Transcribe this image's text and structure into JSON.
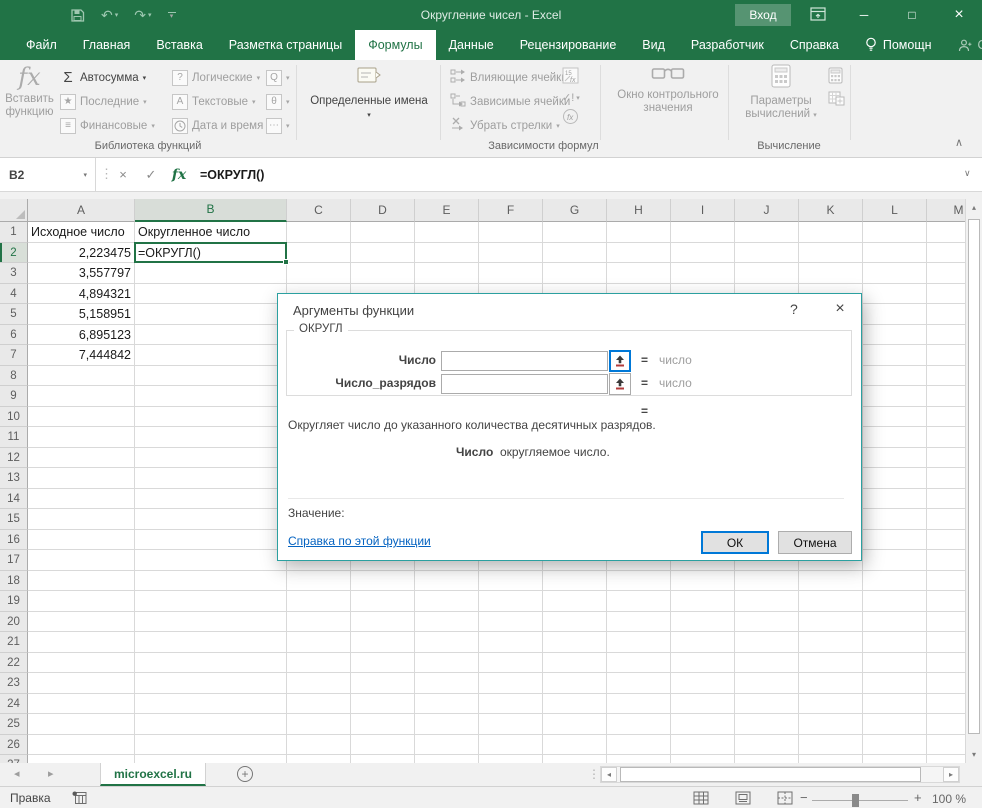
{
  "window": {
    "title": "Округление чисел - Excel",
    "sign_in_label": "Вход",
    "icons": {
      "dropdown": "▾",
      "undo": "↶",
      "redo": "↷",
      "minimize": "─",
      "maximize": "□",
      "close": "×",
      "check": "✓",
      "cancel_x": "×",
      "fx": "fx",
      "sigma": "Σ",
      "star": "★",
      "book": "≡",
      "question": "?",
      "letter_a": "A",
      "lookup": "Q",
      "theta": "θ",
      "dots": "⋯",
      "collapse": "∧",
      "expand": "∨",
      "vdots": "⋮",
      "prev": "◂",
      "next": "▸",
      "up": "▴",
      "down": "▾",
      "left": "◂",
      "right": "▸",
      "plus": "+",
      "check_error": "✓!",
      "minus": "−",
      "help": "?"
    }
  },
  "menu_tabs": [
    {
      "label": "Файл"
    },
    {
      "label": "Главная"
    },
    {
      "label": "Вставка"
    },
    {
      "label": "Разметка страницы"
    },
    {
      "label": "Формулы",
      "active": true
    },
    {
      "label": "Данные"
    },
    {
      "label": "Рецензирование"
    },
    {
      "label": "Вид"
    },
    {
      "label": "Разработчик"
    },
    {
      "label": "Справка"
    },
    {
      "label": "Помощн",
      "bulb": true
    },
    {
      "label": "Общий доступ",
      "person": true,
      "muted": true
    }
  ],
  "ribbon": {
    "insert_function": "Вставить функцию",
    "autosum": "Автосумма",
    "recent": "Последние",
    "financial": "Финансовые",
    "logical": "Логические",
    "text_fns": "Текстовые",
    "datetime": "Дата и время",
    "defined_names": "Определенные имена",
    "precedents": "Влияющие ячейки",
    "dependents": "Зависимые ячейки",
    "remove_arrows": "Убрать стрелки",
    "watch_window": "Окно контрольного значения",
    "calc_options": "Параметры вычислений",
    "group_library": "Библиотека функций",
    "group_dependencies": "Зависимости формул",
    "group_calculation": "Вычисление"
  },
  "formula_bar": {
    "name_box": "B2",
    "formula": "=ОКРУГЛ()"
  },
  "grid": {
    "columns": [
      "A",
      "B",
      "C",
      "D",
      "E",
      "F",
      "G",
      "H",
      "I",
      "J",
      "K",
      "L",
      "M"
    ],
    "col_widths": {
      "A": 107,
      "B": 152,
      "default": 64
    },
    "row_count": 27,
    "active_cell": {
      "col": "B",
      "row": 2,
      "ref": "B2"
    },
    "cells": {
      "A1": "Исходное число",
      "B1": "Округленное число",
      "A2": "2,223475",
      "B2": "=ОКРУГЛ()",
      "A3": "3,557797",
      "A4": "4,894321",
      "A5": "5,158951",
      "A6": "6,895123",
      "A7": "7,444842"
    },
    "right_aligned": [
      "A2",
      "A3",
      "A4",
      "A5",
      "A6",
      "A7"
    ]
  },
  "dialog": {
    "title": "Аргументы функции",
    "function_name": "ОКРУГЛ",
    "fields": [
      {
        "label": "Число",
        "value": "",
        "result": "число"
      },
      {
        "label": "Число_разрядов",
        "value": "",
        "result": "число"
      }
    ],
    "equals": "=",
    "description": "Округляет число до указанного количества десятичных разрядов.",
    "arg_hint_name": "Число",
    "arg_hint_text": "округляемое число.",
    "value_label": "Значение:",
    "help_link": "Справка по этой функции",
    "ok_label": "ОК",
    "cancel_label": "Отмена"
  },
  "sheet_bar": {
    "active_tab": "microexcel.ru"
  },
  "status_bar": {
    "mode_label": "Правка",
    "zoom_label": "100 %"
  }
}
